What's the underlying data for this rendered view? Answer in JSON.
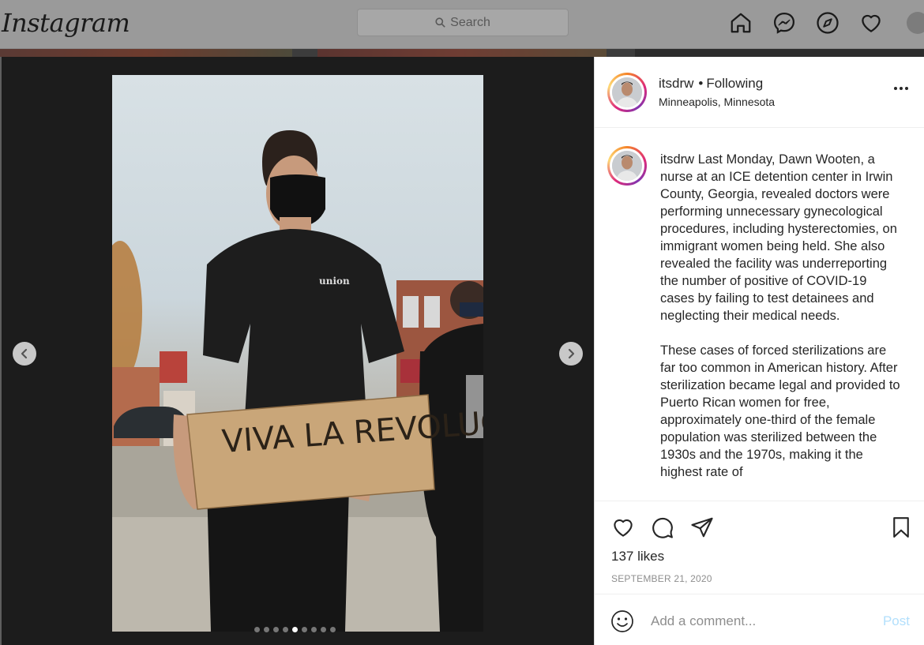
{
  "header": {
    "logo": "Instagram",
    "search_placeholder": "Search",
    "nav_icons": [
      "home-icon",
      "messenger-icon",
      "explore-icon",
      "heart-icon",
      "profile-avatar"
    ]
  },
  "post": {
    "username": "itsdrw",
    "follow_status": "Following",
    "location": "Minneapolis, Minnesota",
    "carousel": {
      "slide_count": 9,
      "active_index": 4
    },
    "photo_sign_text": "VIVA LA REVOLUCIÓN",
    "caption_paragraphs": [
      "Last Monday, Dawn Wooten, a nurse at an ICE detention center in Irwin County, Georgia, revealed doctors were performing unnecessary gynecological procedures, including hysterectomies, on immigrant women being held. She also revealed the facility was underreporting the number of positive of COVID-19 cases by failing to test detainees and neglecting their medical needs.",
      "These cases of forced sterilizations are far too common in American history. After sterilization became legal and provided to Puerto Rican women for free, approximately one-third of the female population was sterilized between the 1930s and the 1970s, making it the highest rate of"
    ],
    "likes": "137 likes",
    "date": "SEPTEMBER 21, 2020",
    "comment_placeholder": "Add a comment...",
    "post_button": "Post"
  },
  "colors": {
    "accent": "#0095f6",
    "post_disabled": "#b2dffc",
    "muted": "#8e8e8e",
    "text": "#262626"
  }
}
